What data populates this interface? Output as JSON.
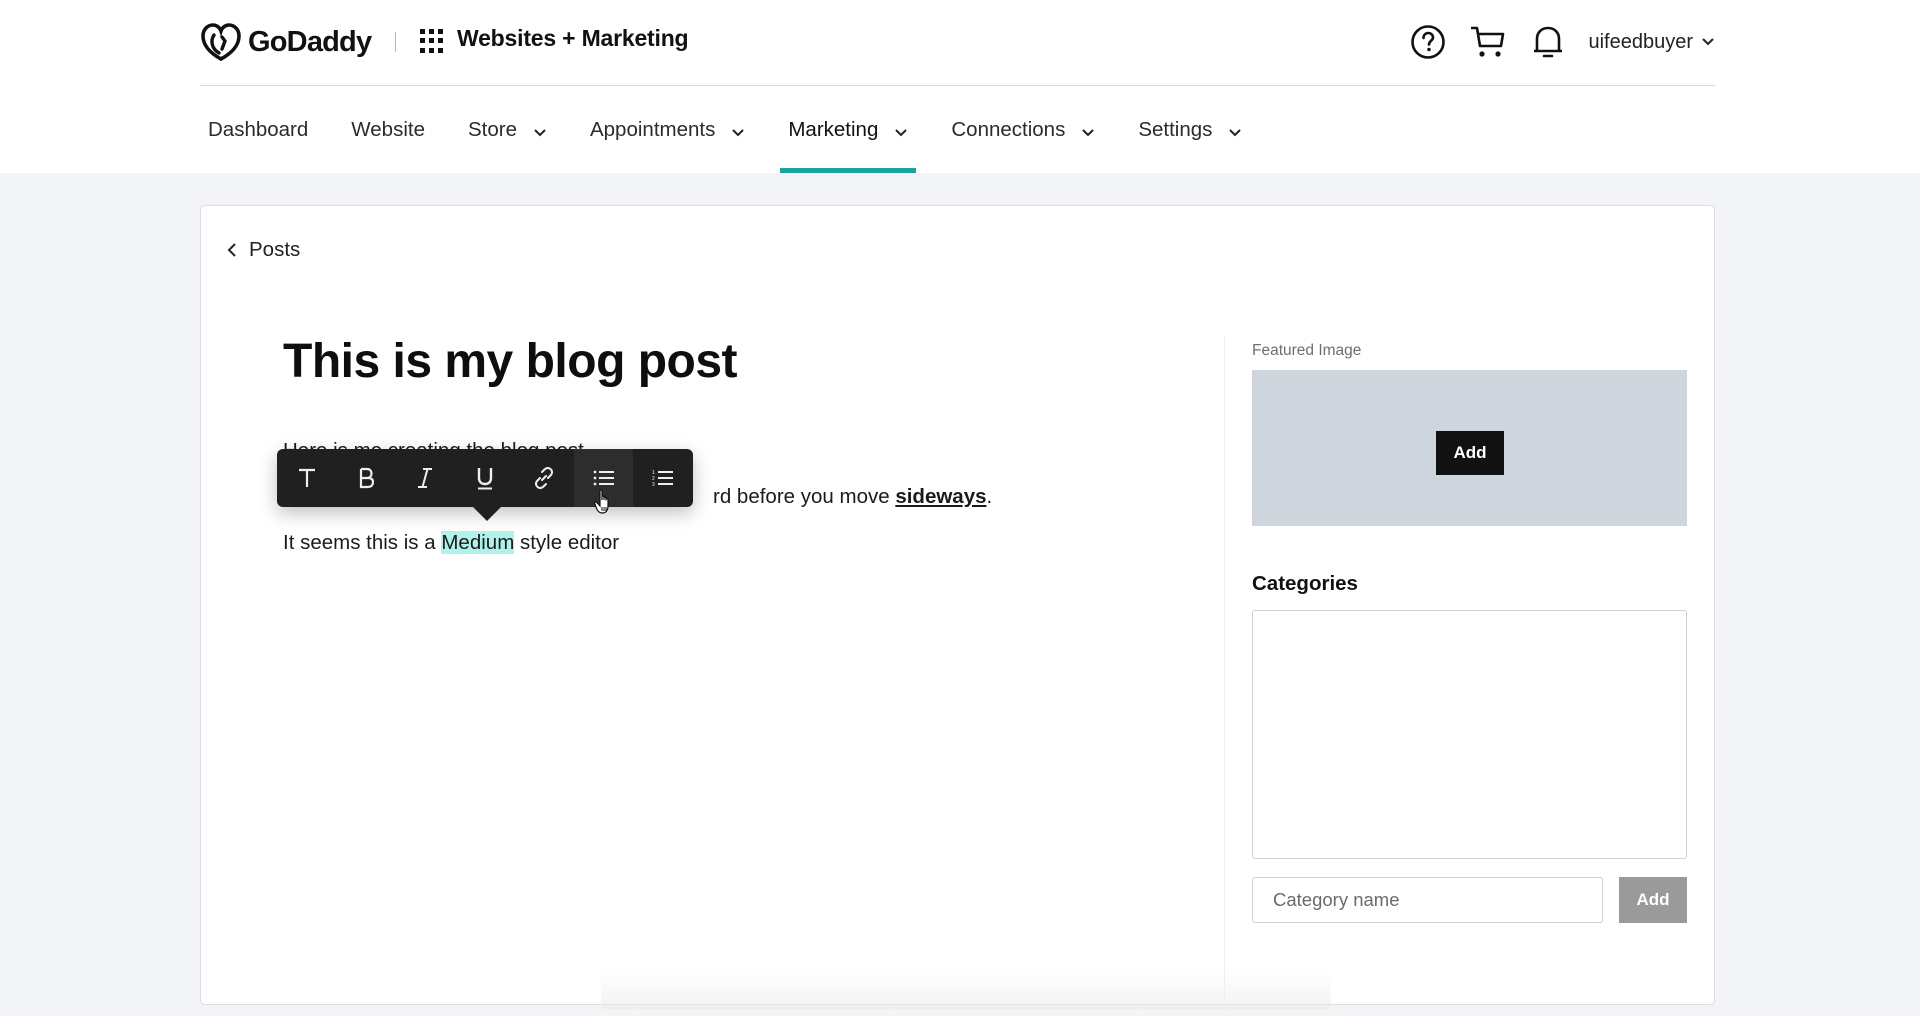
{
  "header": {
    "brand": "GoDaddy",
    "product_title": "Websites + Marketing",
    "icons": [
      "help-icon",
      "cart-icon",
      "bell-icon"
    ],
    "username": "uifeedbuyer"
  },
  "nav": {
    "items": [
      {
        "label": "Dashboard",
        "dropdown": false,
        "active": false
      },
      {
        "label": "Website",
        "dropdown": false,
        "active": false
      },
      {
        "label": "Store",
        "dropdown": true,
        "active": false
      },
      {
        "label": "Appointments",
        "dropdown": true,
        "active": false
      },
      {
        "label": "Marketing",
        "dropdown": true,
        "active": true
      },
      {
        "label": "Connections",
        "dropdown": true,
        "active": false
      },
      {
        "label": "Settings",
        "dropdown": true,
        "active": false
      }
    ],
    "active_color": "#1ba39c"
  },
  "page": {
    "back_label": "Posts",
    "post_title": "This is my blog post",
    "body": {
      "line1": "Here is me creating the blog post",
      "line2_prefix": "rd before you move ",
      "line2_bold": "sideways",
      "line2_suffix": ".",
      "line3_prefix": "It seems this is a ",
      "line3_highlight": "Medium",
      "line3_suffix": " style editor"
    },
    "highlight_color": "#b0f1ea"
  },
  "toolbar": {
    "buttons": [
      {
        "name": "text-style",
        "glyph": "T"
      },
      {
        "name": "bold",
        "glyph": "B"
      },
      {
        "name": "italic",
        "glyph": "I"
      },
      {
        "name": "underline",
        "glyph": "U"
      },
      {
        "name": "link",
        "glyph": "link"
      },
      {
        "name": "bulleted-list",
        "glyph": "ul"
      },
      {
        "name": "numbered-list",
        "glyph": "ol"
      }
    ],
    "hovered": "bulleted-list"
  },
  "sidebar": {
    "featured_image_label": "Featured Image",
    "featured_image_add": "Add",
    "categories_title": "Categories",
    "category_input_placeholder": "Category name",
    "category_input_value": "",
    "category_add": "Add"
  }
}
